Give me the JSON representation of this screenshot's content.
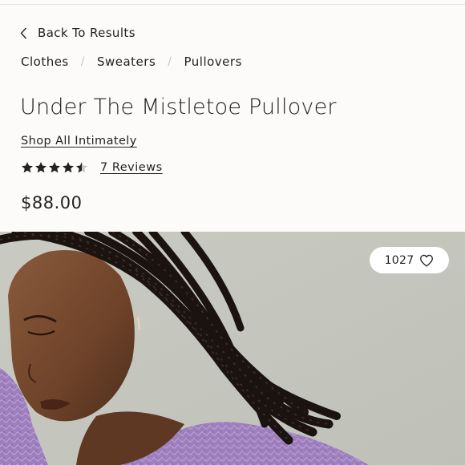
{
  "nav": {
    "back_label": "Back To Results"
  },
  "breadcrumb": {
    "items": [
      "Clothes",
      "Sweaters",
      "Pullovers"
    ],
    "separator": "/"
  },
  "product": {
    "title": "Under The Mistletoe Pullover",
    "shop_all_label": "Shop All Intimately",
    "rating": 4.5,
    "rating_max": 5,
    "reviews_label": "7 Reviews",
    "price": "$88.00",
    "favorites_count": "1027"
  },
  "image": {
    "subject": "model with long braids wearing a lavender knit sweater",
    "background_color": "#c7c8c0",
    "sweater_color": "#9a7ab8"
  },
  "icons": {
    "back": "chevron-left-icon",
    "star": "star-icon",
    "favorite": "heart-icon"
  },
  "colors": {
    "text": "#222222",
    "page_background": "#fdfbf9",
    "separator": "#c8c4c0"
  }
}
